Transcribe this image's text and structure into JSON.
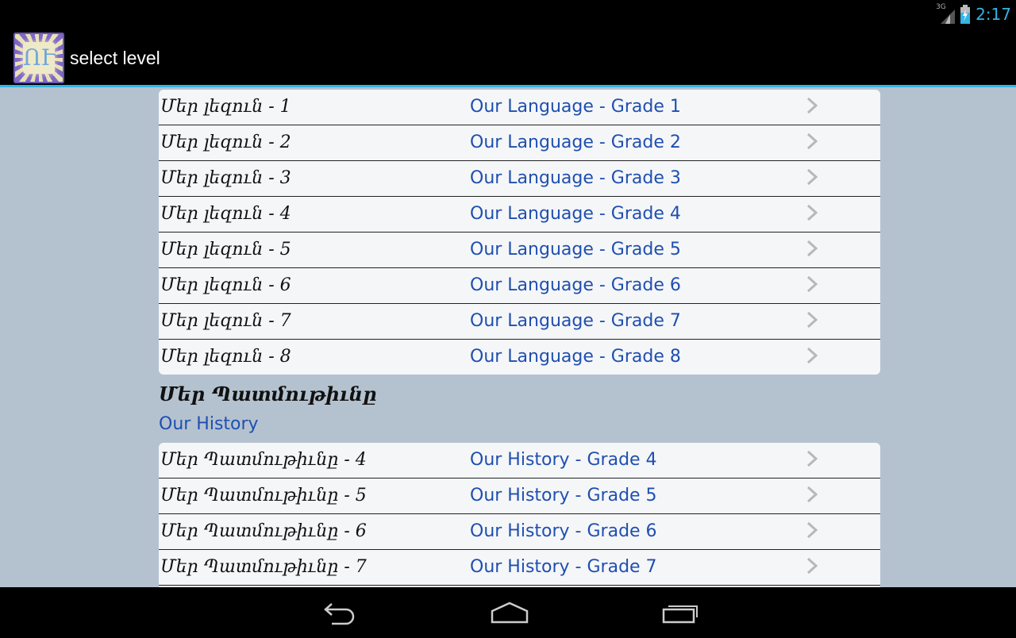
{
  "status_bar": {
    "network": "3G",
    "time": "2:17"
  },
  "action_bar": {
    "app_icon_glyph": "ՈՒ",
    "title": "select level"
  },
  "language_group": {
    "rows": [
      {
        "armenian": "Մեր լեզուն - 1",
        "english": "Our Language - Grade 1"
      },
      {
        "armenian": "Մեր լեզուն - 2",
        "english": "Our Language - Grade 2"
      },
      {
        "armenian": "Մեր լեզուն - 3",
        "english": "Our Language - Grade 3"
      },
      {
        "armenian": "Մեր լեզուն - 4",
        "english": "Our Language - Grade 4"
      },
      {
        "armenian": "Մեր լեզուն - 5",
        "english": "Our Language - Grade 5"
      },
      {
        "armenian": "Մեր լեզուն - 6",
        "english": "Our Language - Grade 6"
      },
      {
        "armenian": "Մեր լեզուն - 7",
        "english": "Our Language - Grade 7"
      },
      {
        "armenian": "Մեր լեզուն - 8",
        "english": "Our Language - Grade 8"
      }
    ]
  },
  "history_section": {
    "title": "Մեր Պատմութիւնը",
    "subtitle": "Our History",
    "rows": [
      {
        "armenian": "Մեր Պատմութիւնը - 4",
        "english": "Our History - Grade 4"
      },
      {
        "armenian": "Մեր Պատմութիւնը - 5",
        "english": "Our History - Grade 5"
      },
      {
        "armenian": "Մեր Պատմութիւնը - 6",
        "english": "Our History - Grade 6"
      },
      {
        "armenian": "Մեր Պատմութիւնը - 7",
        "english": "Our History - Grade 7"
      }
    ]
  },
  "icons": {
    "signal": "signal-icon",
    "battery": "battery-charging-icon",
    "row_chevron": "chevron-right-icon",
    "back": "back-icon",
    "home": "home-icon",
    "recents": "recent-apps-icon"
  },
  "colors": {
    "accent": "#33b5e5",
    "link_blue": "#1f4fb0",
    "background": "#b4c2d0",
    "row_background": "#f5f6f8"
  }
}
